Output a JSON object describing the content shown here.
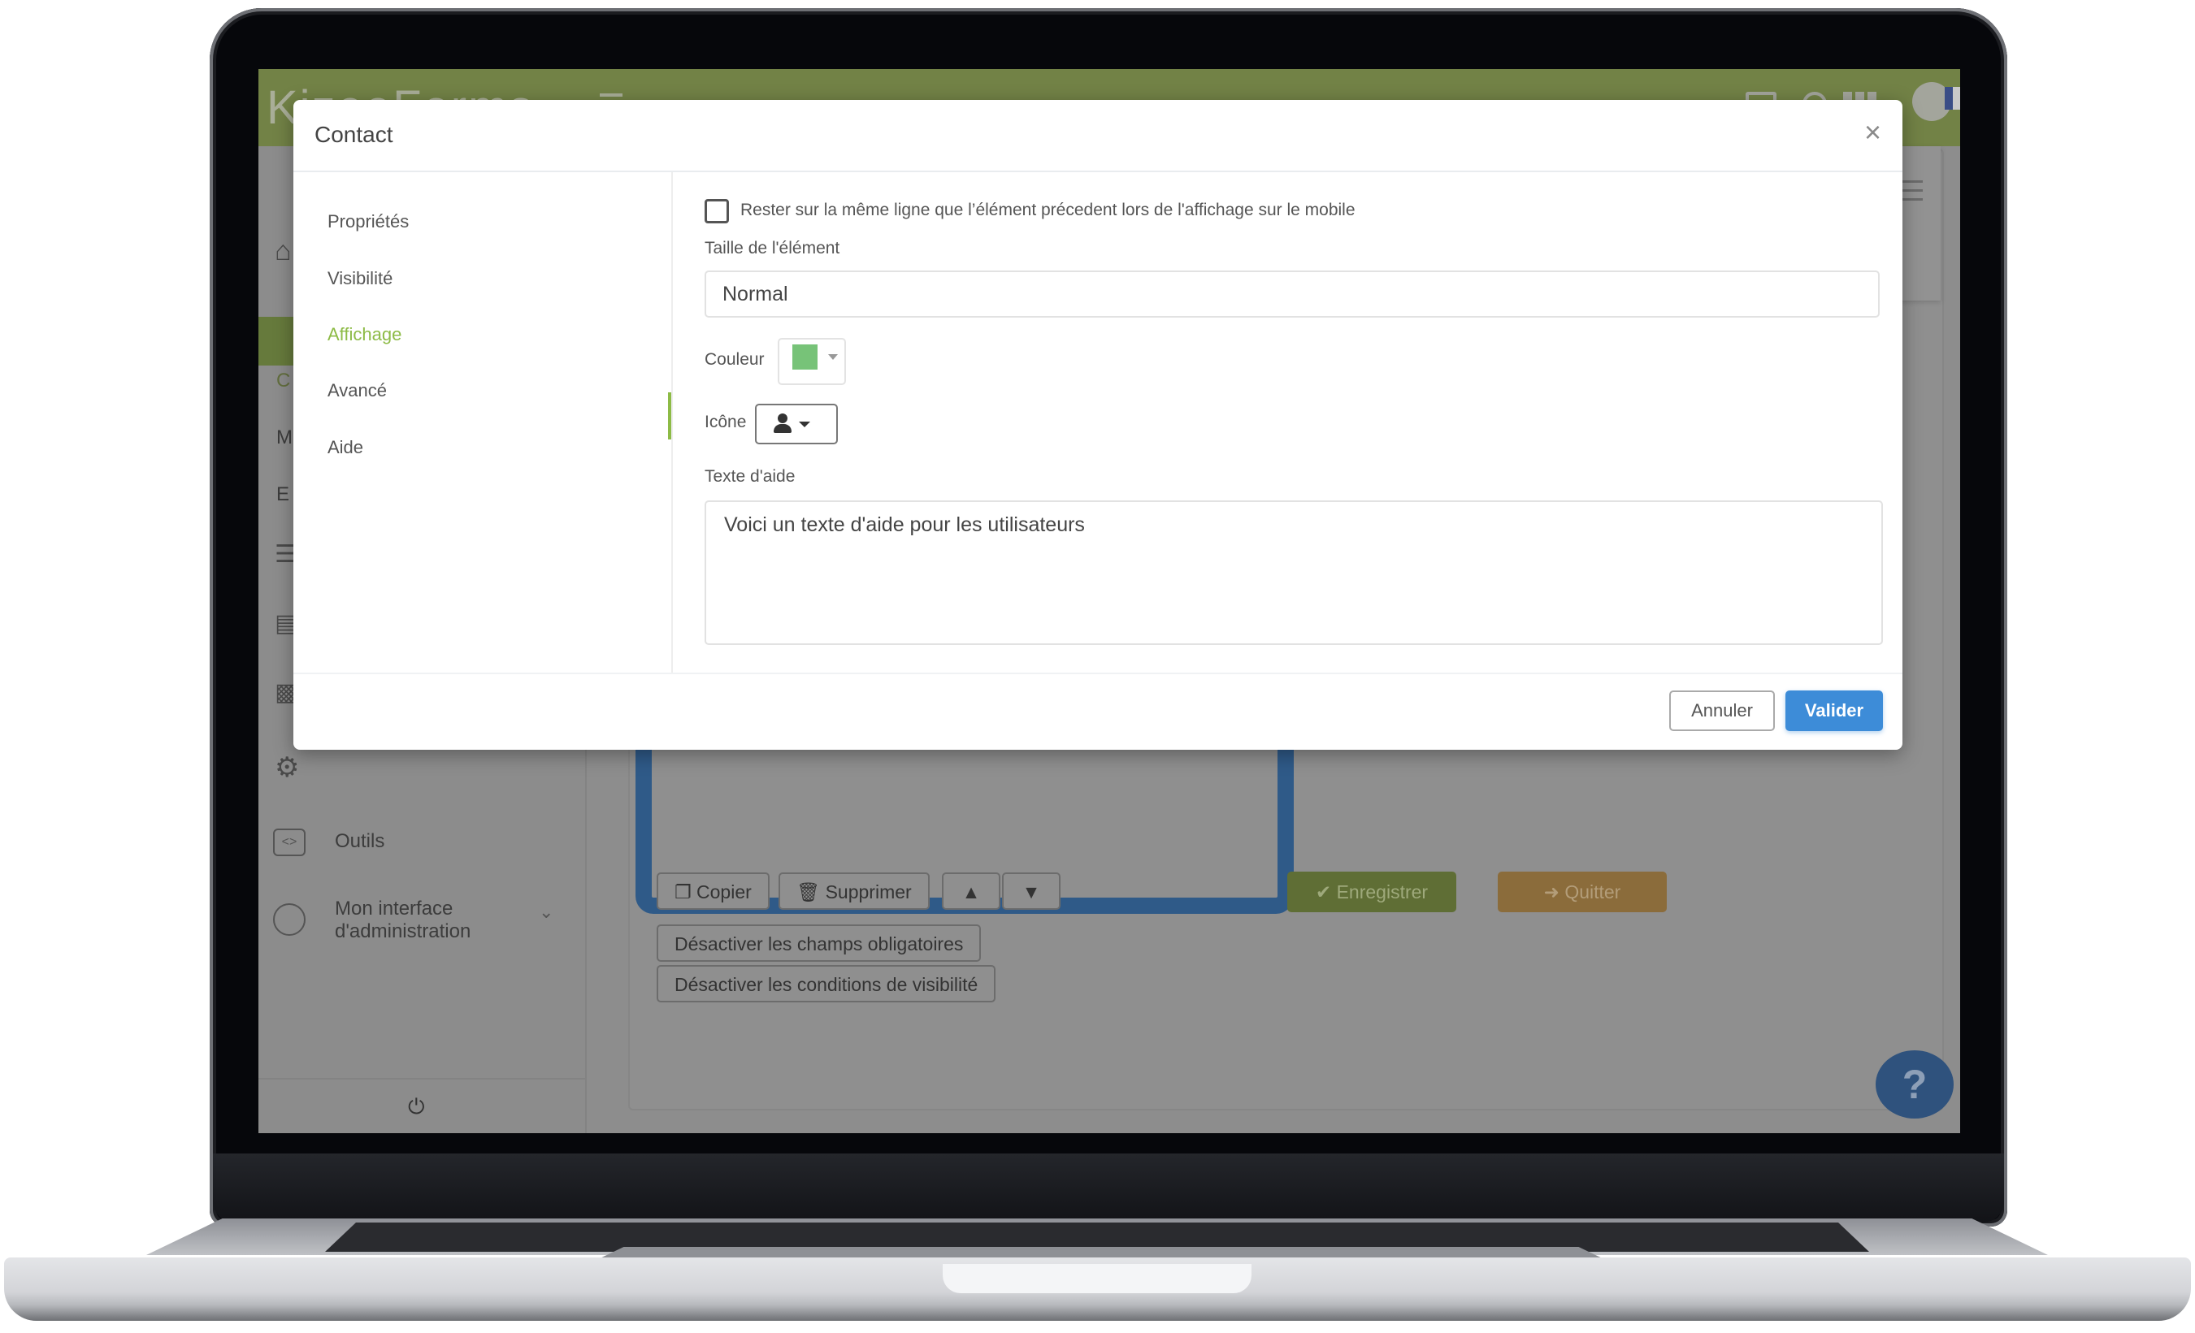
{
  "app": {
    "logo_text": "KizeoForms",
    "language_flag": "fr"
  },
  "background": {
    "sidebar": {
      "items": [
        {
          "icon": "home-icon",
          "label": ""
        },
        {
          "icon": "forms-icon",
          "label": "C",
          "active": true
        },
        {
          "icon": "",
          "label": "M"
        },
        {
          "icon": "",
          "label": "E"
        },
        {
          "icon": "list-icon",
          "label": ""
        },
        {
          "icon": "document-icon",
          "label": ""
        },
        {
          "icon": "chart-icon",
          "label": ""
        },
        {
          "icon": "gear-icon",
          "label": ""
        },
        {
          "icon": "code-icon",
          "label": "Outils"
        },
        {
          "icon": "user-icon",
          "label": "Mon interface d'administration"
        }
      ],
      "footer_icon": "power-icon"
    },
    "toolbar": {
      "copy_label": "Copier",
      "delete_label": "Supprimer",
      "disable_required_label": "Désactiver les champs obligatoires",
      "disable_visibility_label": "Désactiver les conditions de visibilité",
      "save_label": "Enregistrer",
      "quit_label": "Quitter"
    },
    "help_button": "?"
  },
  "modal": {
    "title": "Contact",
    "close_label": "×",
    "nav": [
      {
        "label": "Propriétés",
        "active": false
      },
      {
        "label": "Visibilité",
        "active": false
      },
      {
        "label": "Affichage",
        "active": true
      },
      {
        "label": "Avancé",
        "active": false
      },
      {
        "label": "Aide",
        "active": false
      }
    ],
    "same_line_checkbox": {
      "label": "Rester sur la même ligne que l’élément précedent lors de l'affichage sur le mobile",
      "checked": false
    },
    "size": {
      "label": "Taille de l'élément",
      "value": "Normal"
    },
    "color": {
      "label": "Couleur",
      "value": "#77c378"
    },
    "icon": {
      "label": "Icône",
      "value": "user-icon"
    },
    "help_text": {
      "label": "Texte d'aide",
      "value": "Voici un texte d'aide pour les utilisateurs"
    },
    "cancel_label": "Annuler",
    "submit_label": "Valider"
  },
  "colors": {
    "brand_green": "#728246",
    "active_nav": "#8dbb46",
    "primary_button": "#3d8cd8"
  }
}
